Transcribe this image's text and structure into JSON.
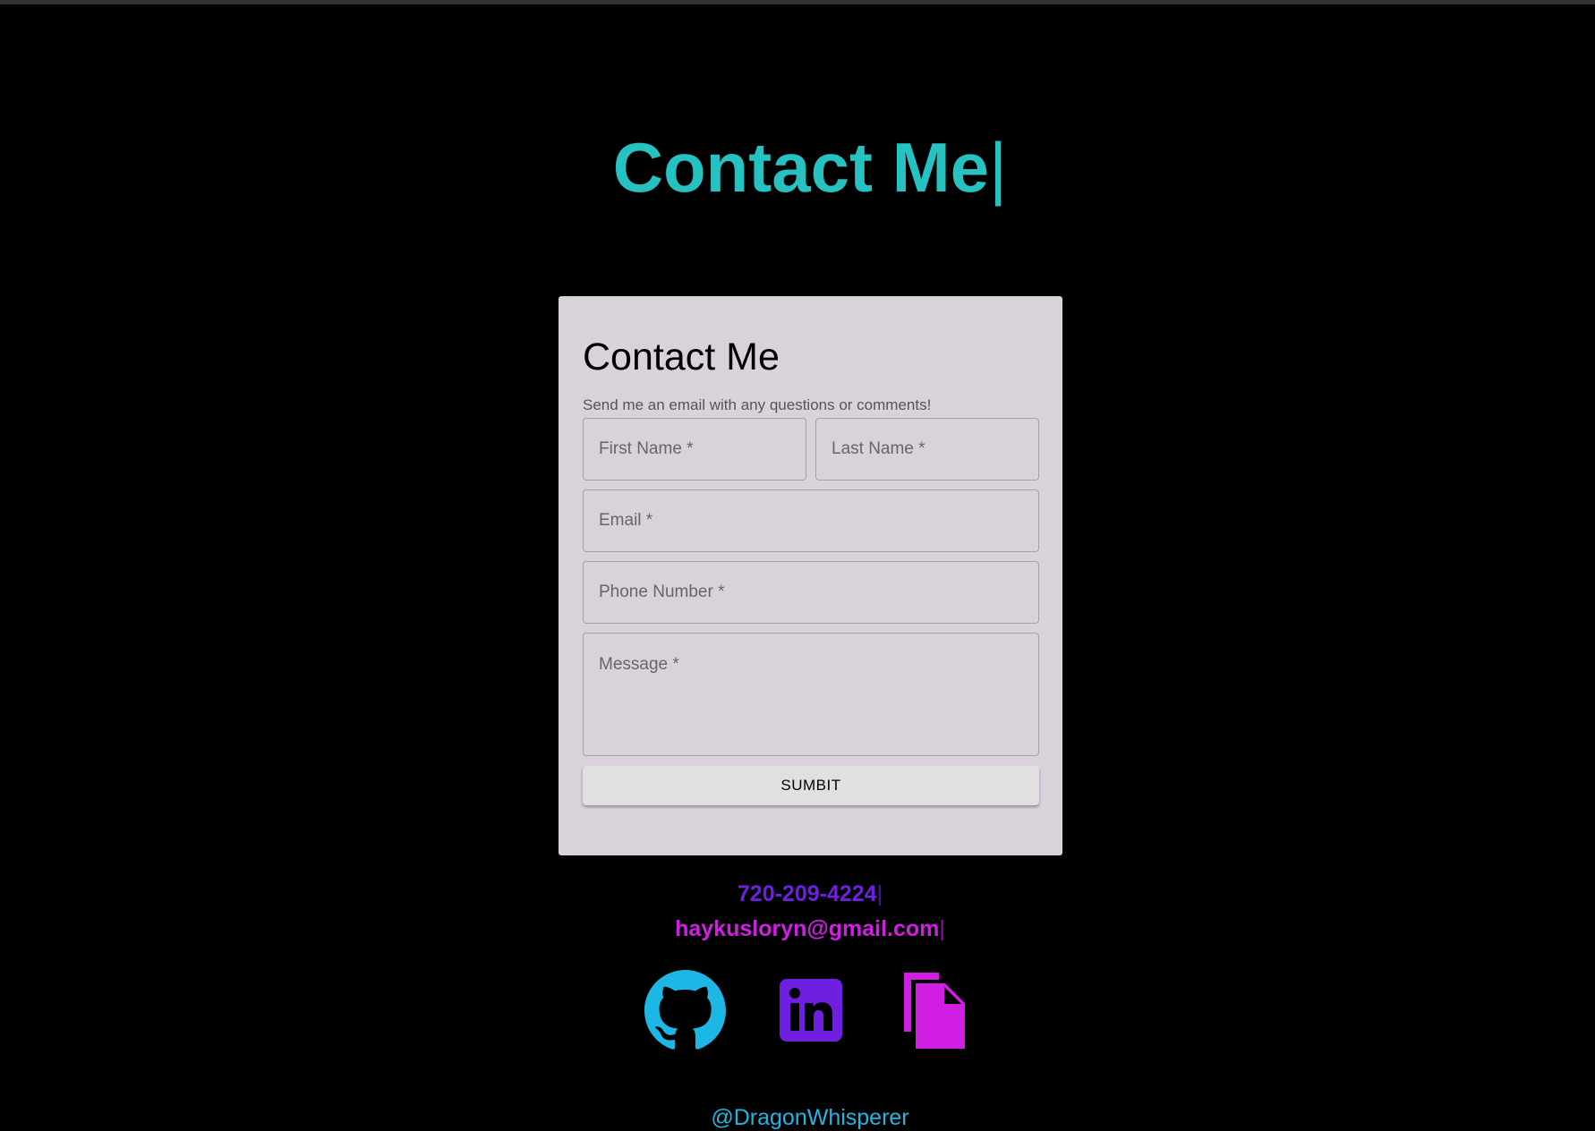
{
  "colors": {
    "background": "#000000",
    "teal": "#26c1c1",
    "purple": "#6f1fe0",
    "magenta": "#d11ee3",
    "cyan": "#1db7e6",
    "card": "#d9d2db"
  },
  "hero": {
    "title": "Contact Me",
    "cursor": "|"
  },
  "form": {
    "title": "Contact Me",
    "subtitle": "Send me an email with any questions or comments!",
    "first_name_placeholder": "First Name *",
    "last_name_placeholder": "Last Name *",
    "email_placeholder": "Email *",
    "phone_placeholder": "Phone Number *",
    "message_placeholder": "Message *",
    "submit_label": "SUMBIT"
  },
  "contact": {
    "phone": "720-209-4224",
    "email": "haykusloryn@gmail.com",
    "cursor": "|"
  },
  "social": {
    "icons": [
      "github-icon",
      "linkedin-icon",
      "document-icon"
    ]
  },
  "footer": {
    "handle": "@DragonWhisperer"
  }
}
